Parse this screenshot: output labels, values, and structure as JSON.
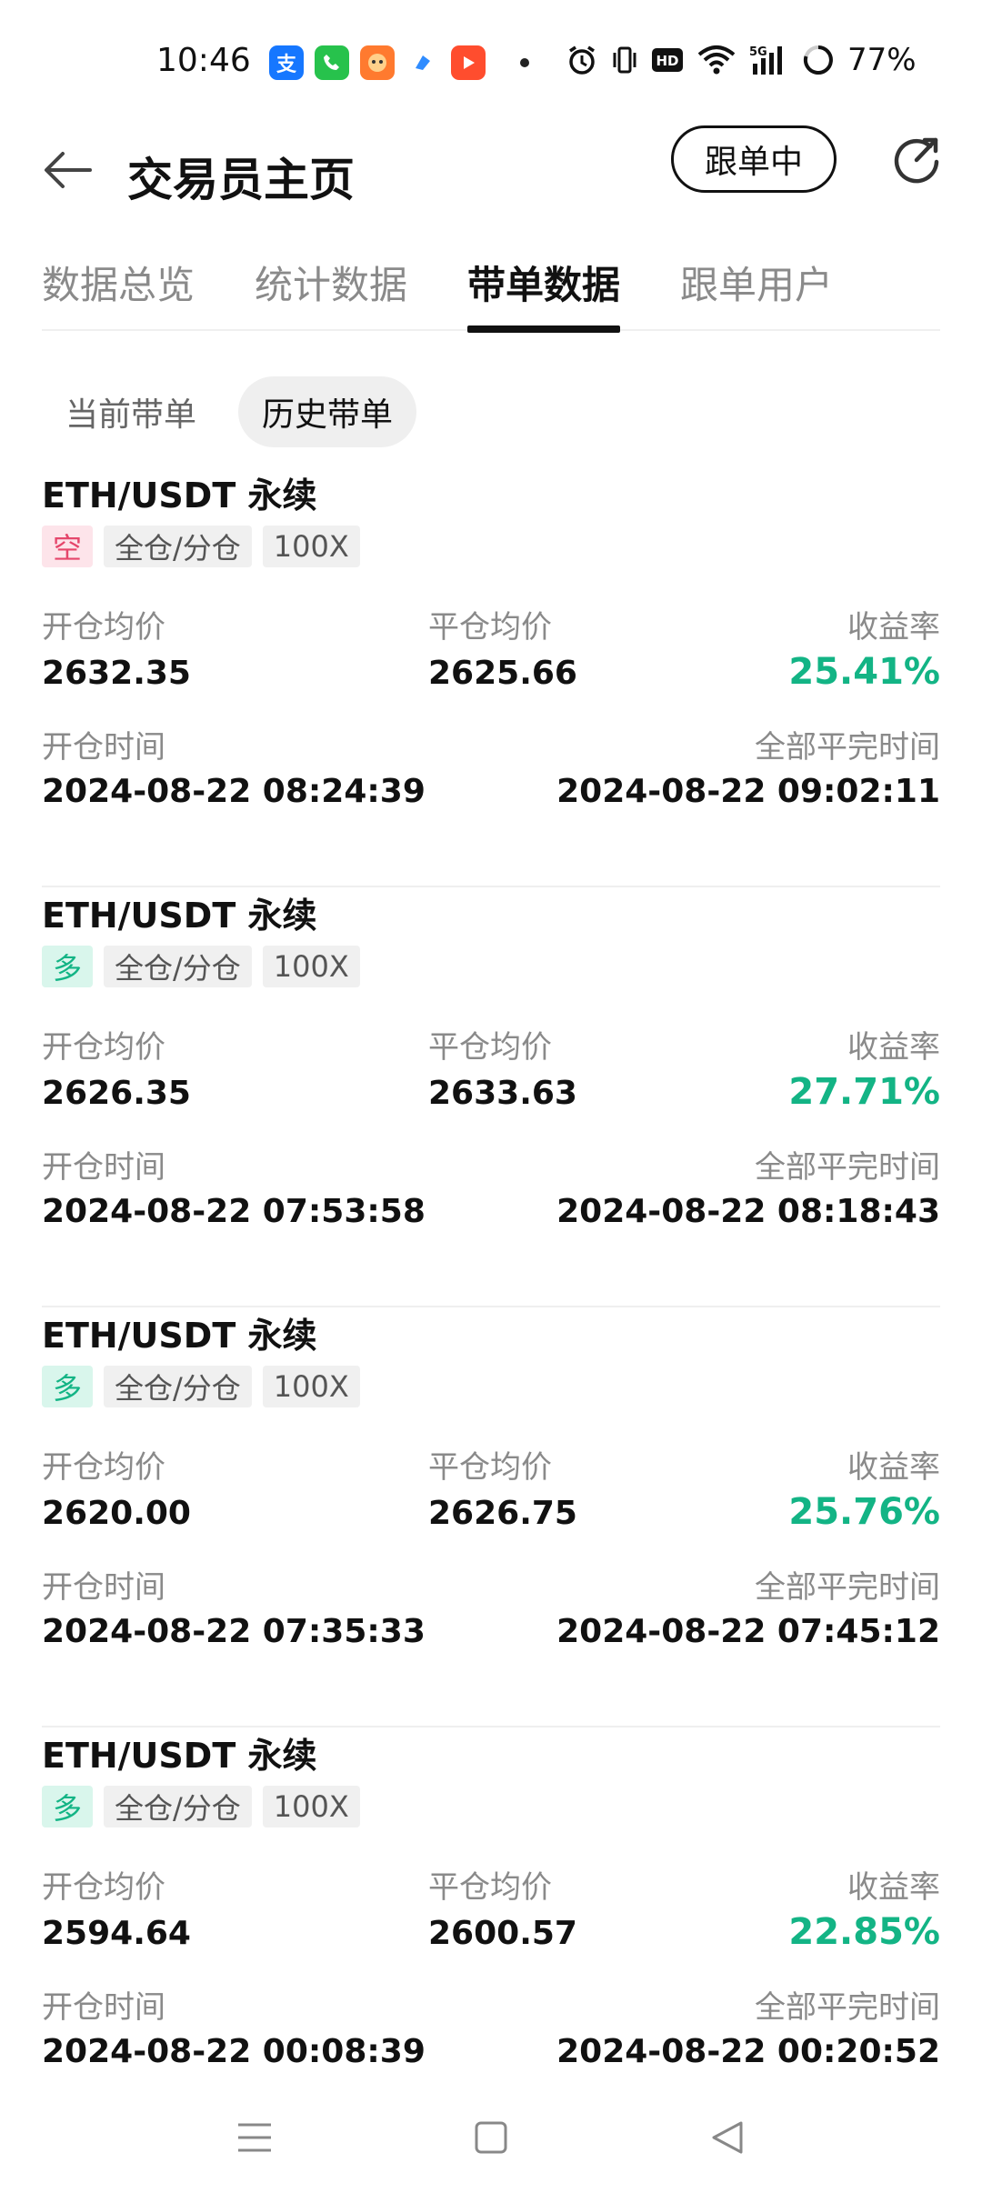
{
  "status_bar": {
    "time": "10:46",
    "battery": "77%",
    "app_icons": [
      "alipay-icon",
      "phone-app-icon",
      "game-app-icon",
      "blue-app-icon",
      "video-app-icon"
    ],
    "system_icons": [
      "alarm-icon",
      "vibrate-icon",
      "hd-icon",
      "wifi-icon",
      "signal-5g-icon",
      "battery-icon"
    ]
  },
  "header": {
    "title": "交易员主页",
    "follow_label": "跟单中"
  },
  "tabs": [
    {
      "label": "数据总览",
      "active": false
    },
    {
      "label": "统计数据",
      "active": false
    },
    {
      "label": "带单数据",
      "active": true
    },
    {
      "label": "跟单用户",
      "active": false
    }
  ],
  "subtabs": [
    {
      "label": "当前带单",
      "active": false
    },
    {
      "label": "历史带单",
      "active": true
    }
  ],
  "field_labels": {
    "open_price": "开仓均价",
    "close_price": "平仓均价",
    "return_rate": "收益率",
    "open_time": "开仓时间",
    "close_time": "全部平完时间"
  },
  "orders": [
    {
      "pair": "ETH/USDT 永续",
      "side": "空",
      "margin_mode": "全仓/分仓",
      "leverage": "100X",
      "open_price": "2632.35",
      "close_price": "2625.66",
      "return_rate": "25.41%",
      "open_time": "2024-08-22 08:24:39",
      "close_time": "2024-08-22 09:02:11"
    },
    {
      "pair": "ETH/USDT 永续",
      "side": "多",
      "margin_mode": "全仓/分仓",
      "leverage": "100X",
      "open_price": "2626.35",
      "close_price": "2633.63",
      "return_rate": "27.71%",
      "open_time": "2024-08-22 07:53:58",
      "close_time": "2024-08-22 08:18:43"
    },
    {
      "pair": "ETH/USDT 永续",
      "side": "多",
      "margin_mode": "全仓/分仓",
      "leverage": "100X",
      "open_price": "2620.00",
      "close_price": "2626.75",
      "return_rate": "25.76%",
      "open_time": "2024-08-22 07:35:33",
      "close_time": "2024-08-22 07:45:12"
    },
    {
      "pair": "ETH/USDT 永续",
      "side": "多",
      "margin_mode": "全仓/分仓",
      "leverage": "100X",
      "open_price": "2594.64",
      "close_price": "2600.57",
      "return_rate": "22.85%",
      "open_time": "2024-08-22 00:08:39",
      "close_time": "2024-08-22 00:20:52"
    }
  ],
  "colors": {
    "profit": "#13b485",
    "short_badge": "#e5466b",
    "long_badge": "#13b485"
  }
}
